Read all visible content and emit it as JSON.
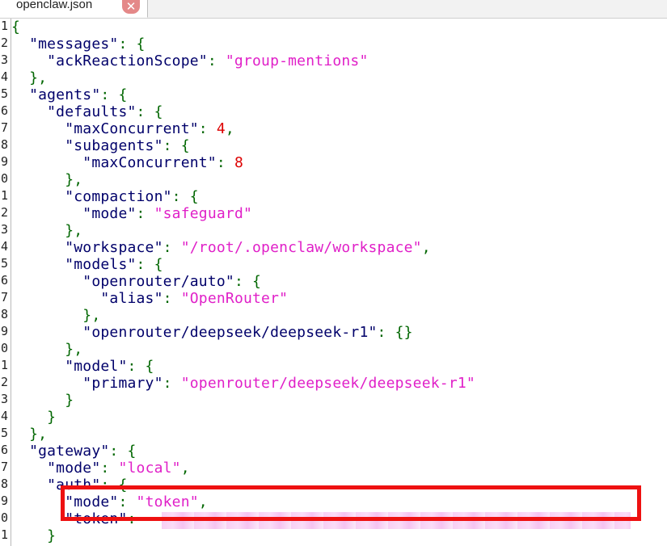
{
  "tab": {
    "title": "openclaw.json",
    "close_glyph": "✕",
    "close_icon": "close-icon"
  },
  "gutter_numbers": [
    "1",
    "2",
    "3",
    "4",
    "5",
    "6",
    "7",
    "8",
    "9",
    "0",
    "1",
    "2",
    "3",
    "4",
    "5",
    "6",
    "7",
    "8",
    "9",
    "0",
    "1",
    "2",
    "3",
    "4",
    "5",
    "6",
    "7",
    "8",
    "9",
    "0",
    "1"
  ],
  "code_lines": [
    [
      [
        "p",
        "{"
      ]
    ],
    [
      [
        "k",
        "  \"messages\""
      ],
      [
        "p",
        ": {"
      ]
    ],
    [
      [
        "k",
        "    \"ackReactionScope\""
      ],
      [
        "p",
        ": "
      ],
      [
        "s",
        "\"group-mentions\""
      ]
    ],
    [
      [
        "p",
        "  },"
      ]
    ],
    [
      [
        "k",
        "  \"agents\""
      ],
      [
        "p",
        ": {"
      ]
    ],
    [
      [
        "k",
        "    \"defaults\""
      ],
      [
        "p",
        ": {"
      ]
    ],
    [
      [
        "k",
        "      \"maxConcurrent\""
      ],
      [
        "p",
        ": "
      ],
      [
        "n",
        "4"
      ],
      [
        "p",
        ","
      ]
    ],
    [
      [
        "k",
        "      \"subagents\""
      ],
      [
        "p",
        ": {"
      ]
    ],
    [
      [
        "k",
        "        \"maxConcurrent\""
      ],
      [
        "p",
        ": "
      ],
      [
        "n",
        "8"
      ]
    ],
    [
      [
        "p",
        "      },"
      ]
    ],
    [
      [
        "k",
        "      \"compaction\""
      ],
      [
        "p",
        ": {"
      ]
    ],
    [
      [
        "k",
        "        \"mode\""
      ],
      [
        "p",
        ": "
      ],
      [
        "s",
        "\"safeguard\""
      ]
    ],
    [
      [
        "p",
        "      },"
      ]
    ],
    [
      [
        "k",
        "      \"workspace\""
      ],
      [
        "p",
        ": "
      ],
      [
        "s",
        "\"/root/.openclaw/workspace\""
      ],
      [
        "p",
        ","
      ]
    ],
    [
      [
        "k",
        "      \"models\""
      ],
      [
        "p",
        ": {"
      ]
    ],
    [
      [
        "k",
        "        \"openrouter/auto\""
      ],
      [
        "p",
        ": {"
      ]
    ],
    [
      [
        "k",
        "          \"alias\""
      ],
      [
        "p",
        ": "
      ],
      [
        "s",
        "\"OpenRouter\""
      ]
    ],
    [
      [
        "p",
        "        },"
      ]
    ],
    [
      [
        "k",
        "        \"openrouter/deepseek/deepseek-r1\""
      ],
      [
        "p",
        ": {}"
      ]
    ],
    [
      [
        "p",
        "      },"
      ]
    ],
    [
      [
        "k",
        "      \"model\""
      ],
      [
        "p",
        ": {"
      ]
    ],
    [
      [
        "k",
        "        \"primary\""
      ],
      [
        "p",
        ": "
      ],
      [
        "s",
        "\"openrouter/deepseek/deepseek-r1\""
      ]
    ],
    [
      [
        "p",
        "      }"
      ]
    ],
    [
      [
        "p",
        "    }"
      ]
    ],
    [
      [
        "p",
        "  },"
      ]
    ],
    [
      [
        "k",
        "  \"gateway\""
      ],
      [
        "p",
        ": {"
      ]
    ],
    [
      [
        "k",
        "    \"mode\""
      ],
      [
        "p",
        ": "
      ],
      [
        "s",
        "\"local\""
      ],
      [
        "p",
        ","
      ]
    ],
    [
      [
        "k",
        "    \"auth\""
      ],
      [
        "p",
        ": {"
      ]
    ],
    [
      [
        "k",
        "      \"mode\""
      ],
      [
        "p",
        ": "
      ],
      [
        "s",
        "\"token\""
      ],
      [
        "p",
        ","
      ]
    ],
    [
      [
        "k",
        "      \"token\""
      ],
      [
        "p",
        ": "
      ]
    ],
    [
      [
        "p",
        "    }"
      ]
    ]
  ]
}
